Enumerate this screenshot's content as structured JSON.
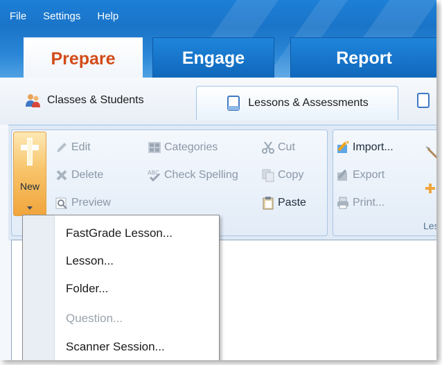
{
  "menu": {
    "items": [
      "File",
      "Settings",
      "Help"
    ]
  },
  "main_tabs": [
    {
      "label": "Prepare",
      "active": true
    },
    {
      "label": "Engage",
      "active": false
    },
    {
      "label": "Report",
      "active": false
    }
  ],
  "sub_tabs": [
    {
      "label": "Classes & Students",
      "icon": "users-icon",
      "active": false
    },
    {
      "label": "Lessons & Assessments",
      "icon": "document-icon",
      "active": true
    }
  ],
  "ribbon": {
    "new_label": "New",
    "edit_group": {
      "edit": "Edit",
      "delete": "Delete",
      "preview": "Preview",
      "categories": "Categories",
      "check_spelling": "Check Spelling",
      "cut": "Cut",
      "copy": "Copy",
      "paste": "Paste"
    },
    "import_group": {
      "import": "Import...",
      "export": "Export",
      "print": "Print...",
      "label": "Less"
    }
  },
  "new_menu": {
    "items": [
      {
        "label": "FastGrade Lesson...",
        "enabled": true
      },
      {
        "label": "Lesson...",
        "enabled": true
      },
      {
        "label": "Folder...",
        "enabled": true
      },
      {
        "label": "Question...",
        "enabled": false
      },
      {
        "label": "Scanner Session...",
        "enabled": true
      }
    ]
  },
  "colors": {
    "banner_blue": "#1a74c8",
    "prepare_orange": "#d24b18",
    "new_button": "#f8c46a"
  }
}
